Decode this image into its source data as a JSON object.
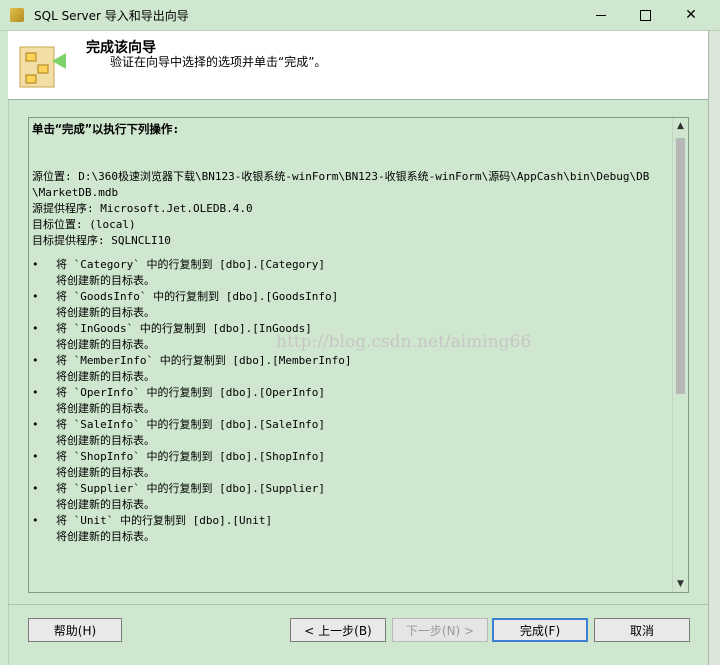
{
  "window": {
    "title": "SQL Server 导入和导出向导"
  },
  "header": {
    "title": "完成该向导",
    "subtitle": "验证在向导中选择的选项并单击“完成”。"
  },
  "summary": {
    "heading": "单击“完成”以执行下列操作:",
    "source_lines": [
      "源位置: D:\\360极速浏览器下载\\BN123-收银系统-winForm\\BN123-收银系统-winForm\\源码\\AppCash\\bin\\Debug\\DB",
      "\\MarketDB.mdb",
      "源提供程序: Microsoft.Jet.OLEDB.4.0",
      "目标位置: (local)",
      "目标提供程序: SQLNCLI10"
    ],
    "bullet": "•",
    "items": [
      {
        "text": "将 `Category` 中的行复制到 [dbo].[Category]",
        "sub": "将创建新的目标表。"
      },
      {
        "text": "将 `GoodsInfo` 中的行复制到 [dbo].[GoodsInfo]",
        "sub": "将创建新的目标表。"
      },
      {
        "text": "将 `InGoods` 中的行复制到 [dbo].[InGoods]",
        "sub": "将创建新的目标表。"
      },
      {
        "text": "将 `MemberInfo` 中的行复制到 [dbo].[MemberInfo]",
        "sub": "将创建新的目标表。"
      },
      {
        "text": "将 `OperInfo` 中的行复制到 [dbo].[OperInfo]",
        "sub": "将创建新的目标表。"
      },
      {
        "text": "将 `SaleInfo` 中的行复制到 [dbo].[SaleInfo]",
        "sub": "将创建新的目标表。"
      },
      {
        "text": "将 `ShopInfo` 中的行复制到 [dbo].[ShopInfo]",
        "sub": "将创建新的目标表。"
      },
      {
        "text": "将 `Supplier` 中的行复制到 [dbo].[Supplier]",
        "sub": "将创建新的目标表。"
      },
      {
        "text": "将 `Unit` 中的行复制到 [dbo].[Unit]",
        "sub": "将创建新的目标表。"
      }
    ]
  },
  "watermark": "http://blog.csdn.net/aiming66",
  "buttons": {
    "help": "帮助(H)",
    "back": "< 上一步(B)",
    "next": "下一步(N) >",
    "finish": "完成(F)",
    "cancel": "取消"
  },
  "icons": {
    "app": "wizard-app-icon",
    "header": "database-wizard-icon",
    "scroll_up": "chevron-up-icon",
    "scroll_down": "chevron-down-icon"
  }
}
